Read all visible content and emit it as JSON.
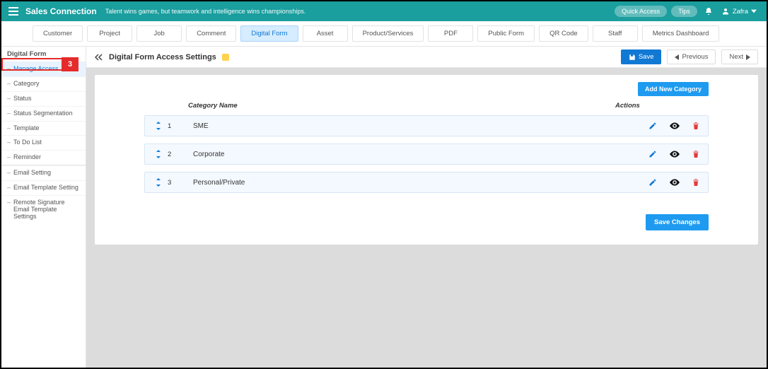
{
  "colors": {
    "teal": "#1a9e9e",
    "blue": "#1178d4",
    "lightblue": "#1e9bf0",
    "red": "#e52b2b"
  },
  "topbar": {
    "brand": "Sales Connection",
    "tagline": "Talent wins games, but teamwork and intelligence wins championships.",
    "quick_access": "Quick Access",
    "tips": "Tips",
    "user_name": "Zafra"
  },
  "tabs": [
    "Customer",
    "Project",
    "Job",
    "Comment",
    "Digital Form",
    "Asset",
    "Product/Services",
    "PDF",
    "Public Form",
    "QR Code",
    "Staff",
    "Metrics Dashboard"
  ],
  "tabs_active_index": 4,
  "sidebar": {
    "header": "Digital Form",
    "groups": [
      [
        "Manage Access",
        "Category",
        "Status",
        "Status Segmentation",
        "Template",
        "To Do List",
        "Reminder"
      ],
      [
        "Email Setting",
        "Email Template Setting",
        "Remote Signature Email Template Settings"
      ]
    ],
    "active_label": "Manage Access"
  },
  "annotation": {
    "number": "3"
  },
  "titlebar": {
    "title": "Digital Form Access Settings",
    "save": "Save",
    "previous": "Previous",
    "next": "Next"
  },
  "panel": {
    "add_new": "Add New Category",
    "col_name": "Category Name",
    "col_actions": "Actions",
    "rows": [
      {
        "n": "1",
        "name": "SME"
      },
      {
        "n": "2",
        "name": "Corporate"
      },
      {
        "n": "3",
        "name": "Personal/Private"
      }
    ],
    "save_changes": "Save Changes"
  }
}
